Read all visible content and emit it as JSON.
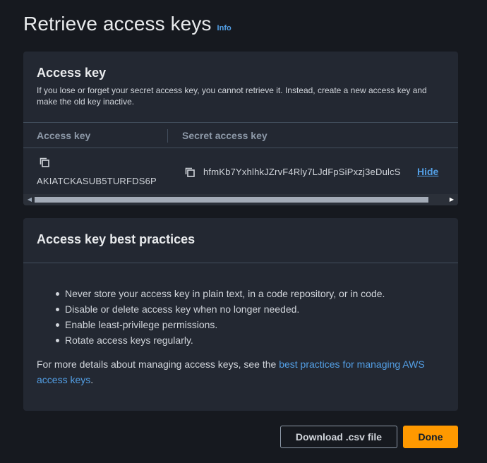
{
  "header": {
    "title": "Retrieve access keys",
    "info_link": "Info"
  },
  "access_key_panel": {
    "title": "Access key",
    "description": "If you lose or forget your secret access key, you cannot retrieve it. Instead, create a new access key and make the old key inactive.",
    "table": {
      "columns": [
        "Access key",
        "Secret access key"
      ],
      "row": {
        "access_key": "AKIATCKASUB5TURFDS6P",
        "secret_access_key": "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",
        "hide_label": "Hide"
      }
    }
  },
  "best_practices_panel": {
    "title": "Access key best practices",
    "items": [
      "Never store your access key in plain text, in a code repository, or in code.",
      "Disable or delete access key when no longer needed.",
      "Enable least-privilege permissions.",
      "Rotate access keys regularly."
    ],
    "footer_prefix": "For more details about managing access keys, see the ",
    "footer_link": "best practices for managing AWS access keys",
    "footer_suffix": "."
  },
  "actions": {
    "download_label": "Download .csv file",
    "done_label": "Done"
  },
  "colors": {
    "accent": "#ff9900",
    "link": "#539fe5",
    "background": "#16191f",
    "panel": "#232832"
  },
  "icons": {
    "copy": "copy-icon",
    "scroll_left": "arrow-left-icon",
    "scroll_right": "arrow-right-icon"
  }
}
